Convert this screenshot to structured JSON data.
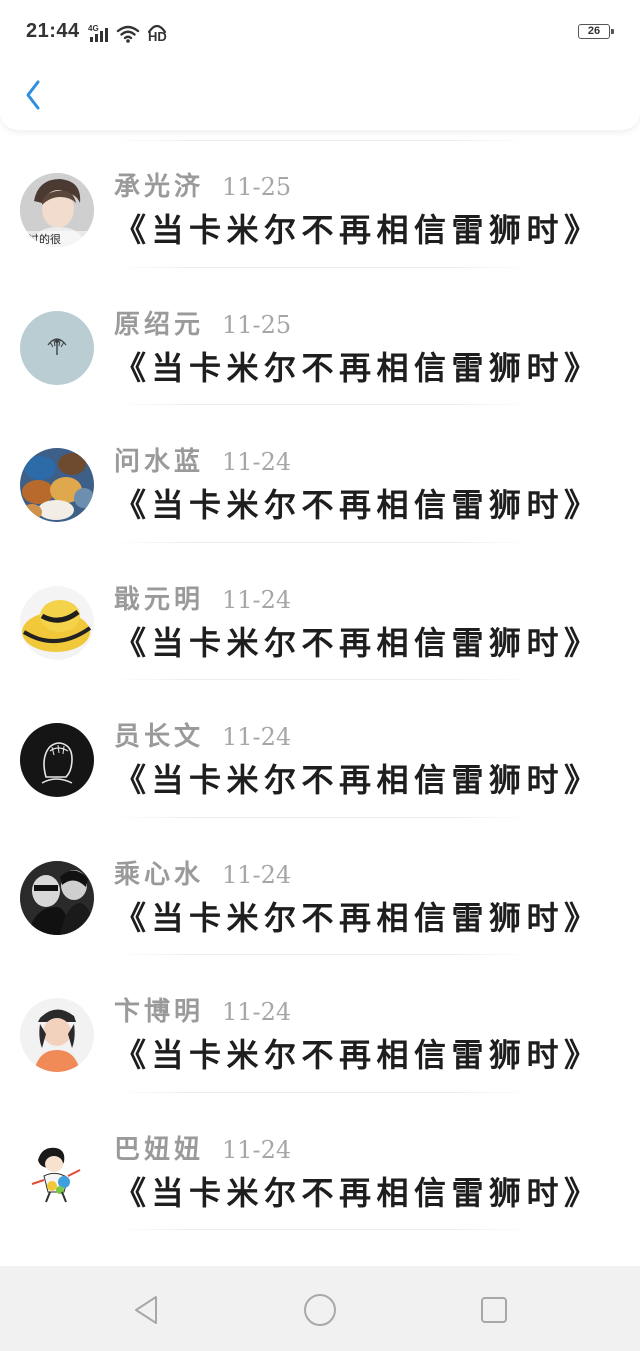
{
  "status_bar": {
    "time": "21:44",
    "network_label": "4G",
    "hd_label": "HD",
    "battery_level": "26"
  },
  "header": {
    "back_icon": "chevron-left-icon",
    "accent_color": "#2e8fe0"
  },
  "list": {
    "items": [
      {
        "username": "承光济",
        "date": "11-25",
        "title": "《当卡米尔不再相信雷狮时》",
        "avatar_caption": "过的很"
      },
      {
        "username": "原绍元",
        "date": "11-25",
        "title": "《当卡米尔不再相信雷狮时》"
      },
      {
        "username": "问水蓝",
        "date": "11-24",
        "title": "《当卡米尔不再相信雷狮时》"
      },
      {
        "username": "戢元明",
        "date": "11-24",
        "title": "《当卡米尔不再相信雷狮时》"
      },
      {
        "username": "员长文",
        "date": "11-24",
        "title": "《当卡米尔不再相信雷狮时》"
      },
      {
        "username": "乘心水",
        "date": "11-24",
        "title": "《当卡米尔不再相信雷狮时》"
      },
      {
        "username": "卞博明",
        "date": "11-24",
        "title": "《当卡米尔不再相信雷狮时》"
      },
      {
        "username": "巴妞妞",
        "date": "11-24",
        "title": "《当卡米尔不再相信雷狮时》"
      }
    ]
  },
  "nav_bar": {
    "back_icon": "triangle-back-icon",
    "home_icon": "circle-home-icon",
    "recents_icon": "square-recents-icon"
  }
}
